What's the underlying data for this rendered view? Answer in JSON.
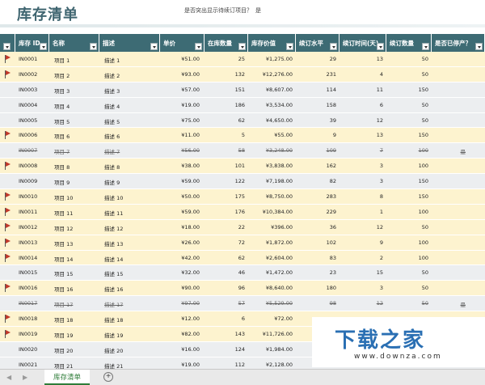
{
  "title": "库存清单",
  "prompt": {
    "question": "是否突出显示待续订项目？",
    "answer": "是"
  },
  "headers": [
    "库存 ID",
    "名称",
    "描述",
    "单价",
    "在库数量",
    "库存价值",
    "续订水平",
    "续订时间(天)",
    "续订数量",
    "是否已停产？"
  ],
  "rows": [
    {
      "flag": true,
      "id": "IN0001",
      "name": "项目 1",
      "desc": "描述 1",
      "price": "¥51.00",
      "qty": "25",
      "value": "¥1,275.00",
      "level": "29",
      "days": "13",
      "order": "50",
      "disc": "",
      "style": "yellow"
    },
    {
      "flag": true,
      "id": "IN0002",
      "name": "项目 2",
      "desc": "描述 2",
      "price": "¥93.00",
      "qty": "132",
      "value": "¥12,276.00",
      "level": "231",
      "days": "4",
      "order": "50",
      "disc": "",
      "style": "yellow"
    },
    {
      "flag": false,
      "id": "IN0003",
      "name": "项目 3",
      "desc": "描述 3",
      "price": "¥57.00",
      "qty": "151",
      "value": "¥8,607.00",
      "level": "114",
      "days": "11",
      "order": "150",
      "disc": "",
      "style": "gray"
    },
    {
      "flag": false,
      "id": "IN0004",
      "name": "项目 4",
      "desc": "描述 4",
      "price": "¥19.00",
      "qty": "186",
      "value": "¥3,534.00",
      "level": "158",
      "days": "6",
      "order": "50",
      "disc": "",
      "style": "gray"
    },
    {
      "flag": false,
      "id": "IN0005",
      "name": "项目 5",
      "desc": "描述 5",
      "price": "¥75.00",
      "qty": "62",
      "value": "¥4,650.00",
      "level": "39",
      "days": "12",
      "order": "50",
      "disc": "",
      "style": "gray"
    },
    {
      "flag": true,
      "id": "IN0006",
      "name": "项目 6",
      "desc": "描述 6",
      "price": "¥11.00",
      "qty": "5",
      "value": "¥55.00",
      "level": "9",
      "days": "13",
      "order": "150",
      "disc": "",
      "style": "yellow"
    },
    {
      "flag": false,
      "id": "IN0007",
      "name": "项目 7",
      "desc": "描述 7",
      "price": "¥56.00",
      "qty": "58",
      "value": "¥3,248.00",
      "level": "109",
      "days": "7",
      "order": "100",
      "disc": "是",
      "style": "stale"
    },
    {
      "flag": true,
      "id": "IN0008",
      "name": "项目 8",
      "desc": "描述 8",
      "price": "¥38.00",
      "qty": "101",
      "value": "¥3,838.00",
      "level": "162",
      "days": "3",
      "order": "100",
      "disc": "",
      "style": "yellow"
    },
    {
      "flag": false,
      "id": "IN0009",
      "name": "项目 9",
      "desc": "描述 9",
      "price": "¥59.00",
      "qty": "122",
      "value": "¥7,198.00",
      "level": "82",
      "days": "3",
      "order": "150",
      "disc": "",
      "style": "gray"
    },
    {
      "flag": true,
      "id": "IN0010",
      "name": "项目 10",
      "desc": "描述 10",
      "price": "¥50.00",
      "qty": "175",
      "value": "¥8,750.00",
      "level": "283",
      "days": "8",
      "order": "150",
      "disc": "",
      "style": "yellow"
    },
    {
      "flag": true,
      "id": "IN0011",
      "name": "项目 11",
      "desc": "描述 11",
      "price": "¥59.00",
      "qty": "176",
      "value": "¥10,384.00",
      "level": "229",
      "days": "1",
      "order": "100",
      "disc": "",
      "style": "yellow"
    },
    {
      "flag": true,
      "id": "IN0012",
      "name": "项目 12",
      "desc": "描述 12",
      "price": "¥18.00",
      "qty": "22",
      "value": "¥396.00",
      "level": "36",
      "days": "12",
      "order": "50",
      "disc": "",
      "style": "yellow"
    },
    {
      "flag": true,
      "id": "IN0013",
      "name": "项目 13",
      "desc": "描述 13",
      "price": "¥26.00",
      "qty": "72",
      "value": "¥1,872.00",
      "level": "102",
      "days": "9",
      "order": "100",
      "disc": "",
      "style": "yellow"
    },
    {
      "flag": true,
      "id": "IN0014",
      "name": "项目 14",
      "desc": "描述 14",
      "price": "¥42.00",
      "qty": "62",
      "value": "¥2,604.00",
      "level": "83",
      "days": "2",
      "order": "100",
      "disc": "",
      "style": "yellow"
    },
    {
      "flag": false,
      "id": "IN0015",
      "name": "项目 15",
      "desc": "描述 15",
      "price": "¥32.00",
      "qty": "46",
      "value": "¥1,472.00",
      "level": "23",
      "days": "15",
      "order": "50",
      "disc": "",
      "style": "gray"
    },
    {
      "flag": true,
      "id": "IN0016",
      "name": "项目 16",
      "desc": "描述 16",
      "price": "¥90.00",
      "qty": "96",
      "value": "¥8,640.00",
      "level": "180",
      "days": "3",
      "order": "50",
      "disc": "",
      "style": "yellow"
    },
    {
      "flag": false,
      "id": "IN0017",
      "name": "项目 17",
      "desc": "描述 17",
      "price": "¥97.00",
      "qty": "57",
      "value": "¥5,529.00",
      "level": "98",
      "days": "12",
      "order": "50",
      "disc": "是",
      "style": "stale"
    },
    {
      "flag": true,
      "id": "IN0018",
      "name": "项目 18",
      "desc": "描述 18",
      "price": "¥12.00",
      "qty": "6",
      "value": "¥72.00",
      "level": "",
      "days": "",
      "order": "",
      "disc": "",
      "style": "yellow"
    },
    {
      "flag": true,
      "id": "IN0019",
      "name": "项目 19",
      "desc": "描述 19",
      "price": "¥82.00",
      "qty": "143",
      "value": "¥11,726.00",
      "level": "",
      "days": "",
      "order": "",
      "disc": "",
      "style": "yellow"
    },
    {
      "flag": false,
      "id": "IN0020",
      "name": "项目 20",
      "desc": "描述 20",
      "price": "¥16.00",
      "qty": "124",
      "value": "¥1,984.00",
      "level": "",
      "days": "",
      "order": "",
      "disc": "",
      "style": "gray"
    },
    {
      "flag": false,
      "id": "IN0021",
      "name": "项目 21",
      "desc": "描述 21",
      "price": "¥19.00",
      "qty": "112",
      "value": "¥2,128.00",
      "level": "",
      "days": "",
      "order": "",
      "disc": "",
      "style": "gray"
    }
  ],
  "sheet_tab": "库存清单",
  "add_sheet": "+",
  "nav": {
    "prev": "◀",
    "next": "▶"
  },
  "watermark": {
    "main": "下载之家",
    "sub": "www.downza.com"
  },
  "colors": {
    "header": "#3d6b74",
    "highlight": "#fdf3cf",
    "normal": "#eceef0",
    "title": "#3f6570",
    "flag": "#c0392b",
    "tab": "#2f7d3a"
  }
}
